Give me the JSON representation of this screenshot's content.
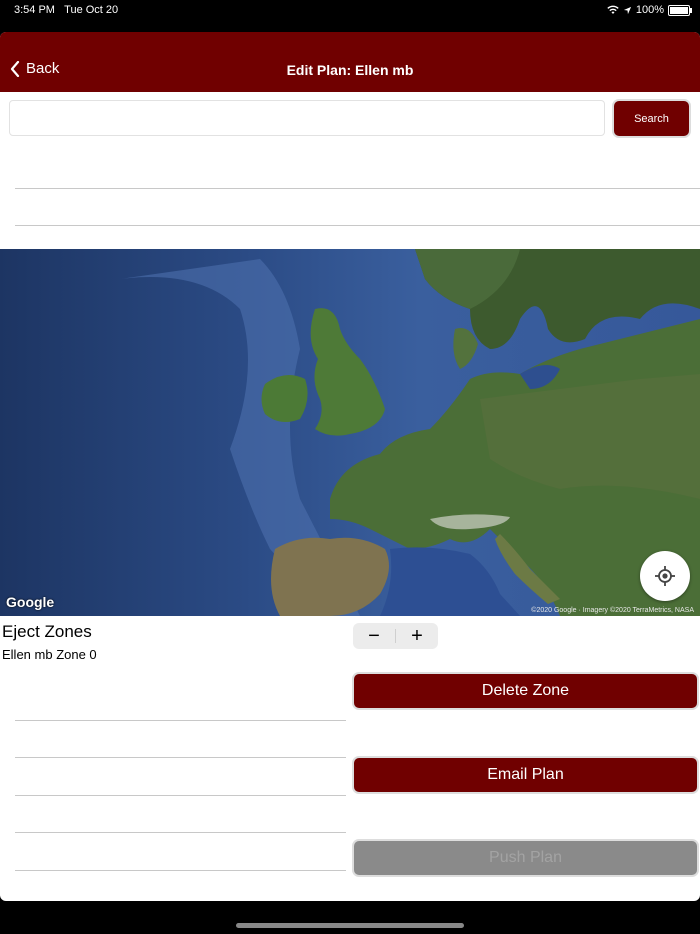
{
  "status": {
    "time": "3:54 PM",
    "date": "Tue Oct 20",
    "battery": "100%",
    "battery_level": 1.0
  },
  "nav": {
    "back_label": "Back",
    "title": "Edit Plan: Ellen mb"
  },
  "search": {
    "value": "",
    "placeholder": "",
    "button_label": "Search"
  },
  "map": {
    "logo": "Google",
    "attribution": "©2020 Google · Imagery ©2020 TerraMetrics, NASA",
    "locate_icon": "crosshair-icon"
  },
  "zones": {
    "title": "Eject Zones",
    "items": [
      "Ellen mb Zone 0"
    ]
  },
  "stepper": {
    "minus": "−",
    "plus": "+"
  },
  "actions": {
    "delete_zone": "Delete Zone",
    "email_plan": "Email Plan",
    "push_plan": "Push Plan"
  },
  "colors": {
    "brand": "#700000",
    "disabled": "#8a8a8a"
  }
}
